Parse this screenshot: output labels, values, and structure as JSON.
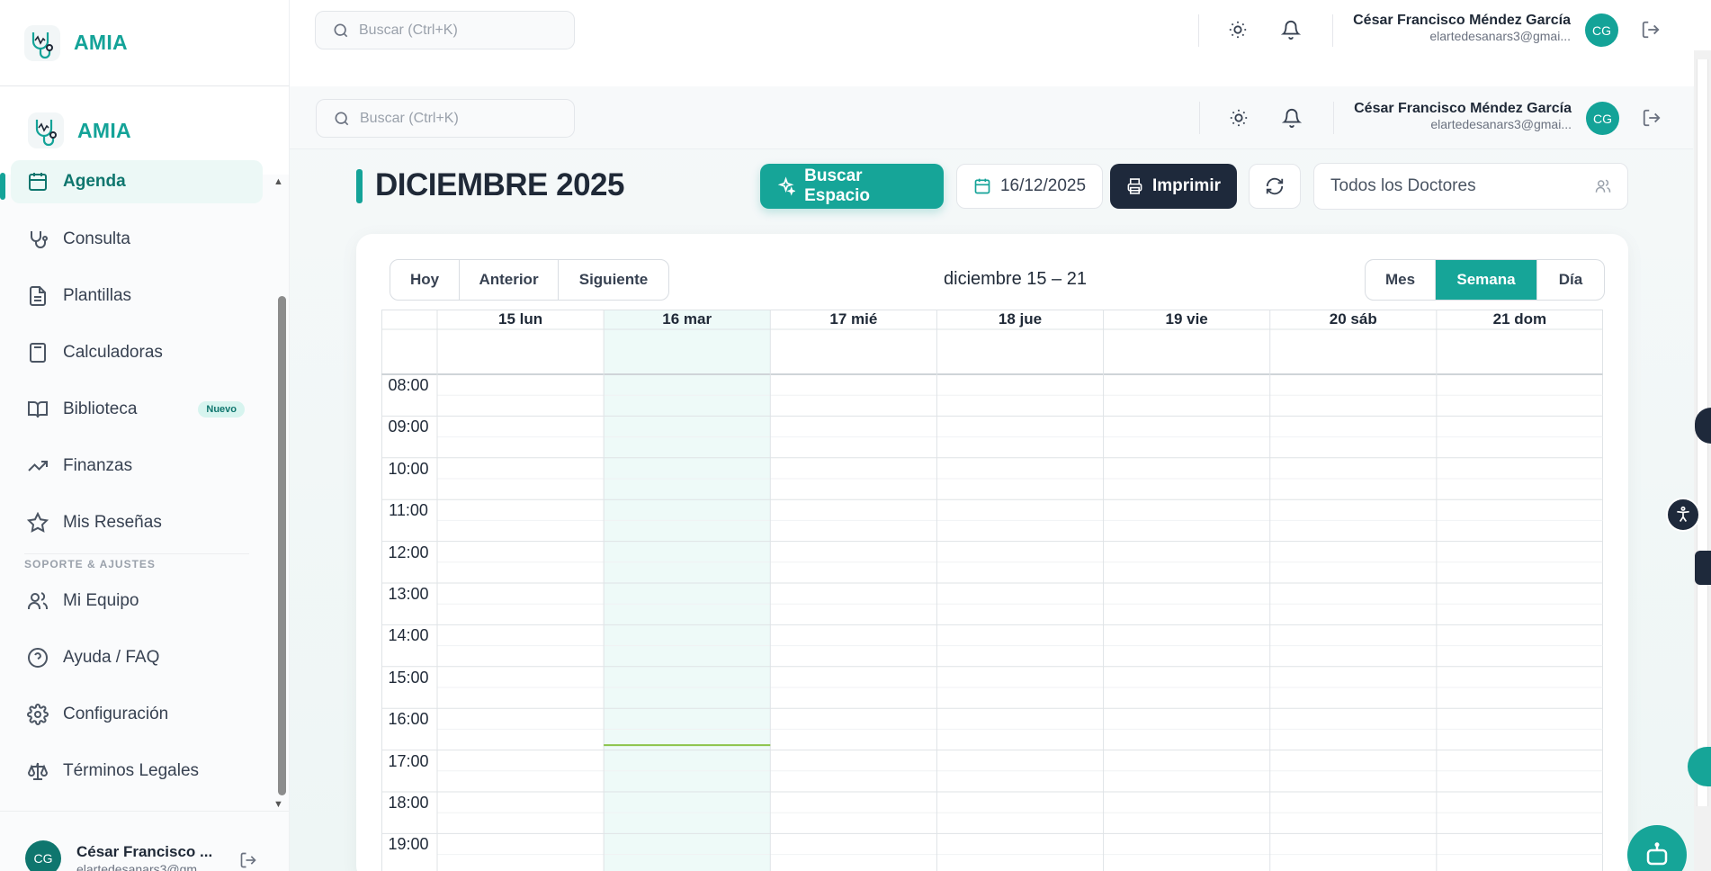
{
  "app": {
    "name": "AMIA"
  },
  "search": {
    "placeholder": "Buscar (Ctrl+K)"
  },
  "user": {
    "name": "César Francisco Méndez García",
    "email": "elartedesanars3@gmai...",
    "initials": "CG",
    "sidebar_name": "César Francisco ...",
    "sidebar_email": "elartedesanars3@gm..."
  },
  "sidebar": {
    "items": [
      {
        "label": "Agenda",
        "icon": "calendar-icon"
      },
      {
        "label": "Consulta",
        "icon": "stethoscope-icon"
      },
      {
        "label": "Plantillas",
        "icon": "file-text-icon"
      },
      {
        "label": "Calculadoras",
        "icon": "calculator-icon"
      },
      {
        "label": "Biblioteca",
        "icon": "book-open-icon",
        "badge": "Nuevo"
      },
      {
        "label": "Finanzas",
        "icon": "trending-up-icon"
      },
      {
        "label": "Mis Reseñas",
        "icon": "star-icon"
      }
    ],
    "section_support": "SOPORTE & AJUSTES",
    "support_items": [
      {
        "label": "Mi Equipo",
        "icon": "users-icon"
      },
      {
        "label": "Ayuda / FAQ",
        "icon": "help-circle-icon"
      },
      {
        "label": "Configuración",
        "icon": "gear-icon"
      },
      {
        "label": "Términos Legales",
        "icon": "scale-icon"
      }
    ]
  },
  "toolbar": {
    "month_title": "DICIEMBRE 2025",
    "find_slot_label": "Buscar Espacio",
    "date_value": "16/12/2025",
    "print_label": "Imprimir",
    "doctor_filter": "Todos los Doctores"
  },
  "calendar": {
    "nav": [
      "Hoy",
      "Anterior",
      "Siguiente"
    ],
    "range_label": "diciembre 15 – 21",
    "views": [
      "Mes",
      "Semana",
      "Día"
    ],
    "active_view": "Semana",
    "days": [
      "15 lun",
      "16 mar",
      "17 mié",
      "18 jue",
      "19 vie",
      "20 sáb",
      "21 dom"
    ],
    "today_index": 1,
    "hours": [
      "08:00",
      "09:00",
      "10:00",
      "11:00",
      "12:00",
      "13:00",
      "14:00",
      "15:00",
      "16:00",
      "17:00",
      "18:00",
      "19:00"
    ],
    "now_line": "16:53"
  },
  "colors": {
    "accent": "#16a598",
    "dark": "#1e293b",
    "today_bg": "#eefaf8"
  }
}
